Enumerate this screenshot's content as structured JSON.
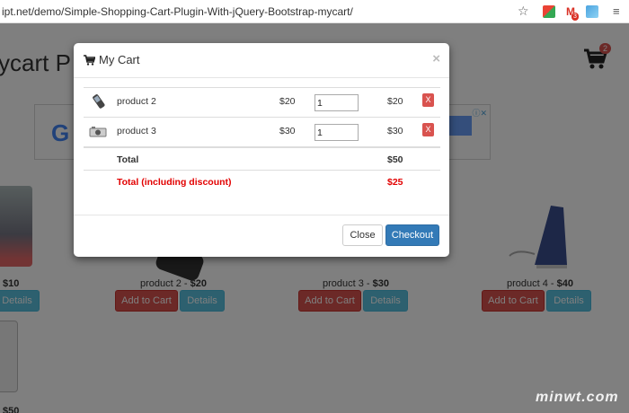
{
  "browser": {
    "url": "ipt.net/demo/Simple-Shopping-Cart-Plugin-With-jQuery-Bootstrap-mycart/",
    "gmail_badge": "3"
  },
  "page": {
    "title": "ycart P",
    "cart_badge": "2",
    "ad_text": "讚",
    "products": [
      {
        "name": "",
        "price": "$10",
        "details_label": "Details"
      },
      {
        "name": "product 2",
        "price": "$20",
        "add_label": "Add to Cart",
        "details_label": "Details"
      },
      {
        "name": "product 3",
        "price": "$30",
        "add_label": "Add to Cart",
        "details_label": "Details"
      },
      {
        "name": "product 4",
        "price": "$40",
        "add_label": "Add to Cart",
        "details_label": "Details"
      },
      {
        "name": "",
        "price": "$50"
      }
    ]
  },
  "modal": {
    "title": "My Cart",
    "close_x": "×",
    "items": [
      {
        "name": "product 2",
        "price": "$20",
        "quantity": "1",
        "subtotal": "$20",
        "remove_label": "X"
      },
      {
        "name": "product 3",
        "price": "$30",
        "quantity": "1",
        "subtotal": "$30",
        "remove_label": "X"
      }
    ],
    "total_label": "Total",
    "total_value": "$50",
    "discount_label": "Total (including discount)",
    "discount_value": "$25",
    "close_label": "Close",
    "checkout_label": "Checkout"
  },
  "watermark": "minwt.com",
  "colors": {
    "danger": "#d9534f",
    "info": "#5bc0de",
    "primary": "#337ab7",
    "discount_text": "#e20000"
  }
}
